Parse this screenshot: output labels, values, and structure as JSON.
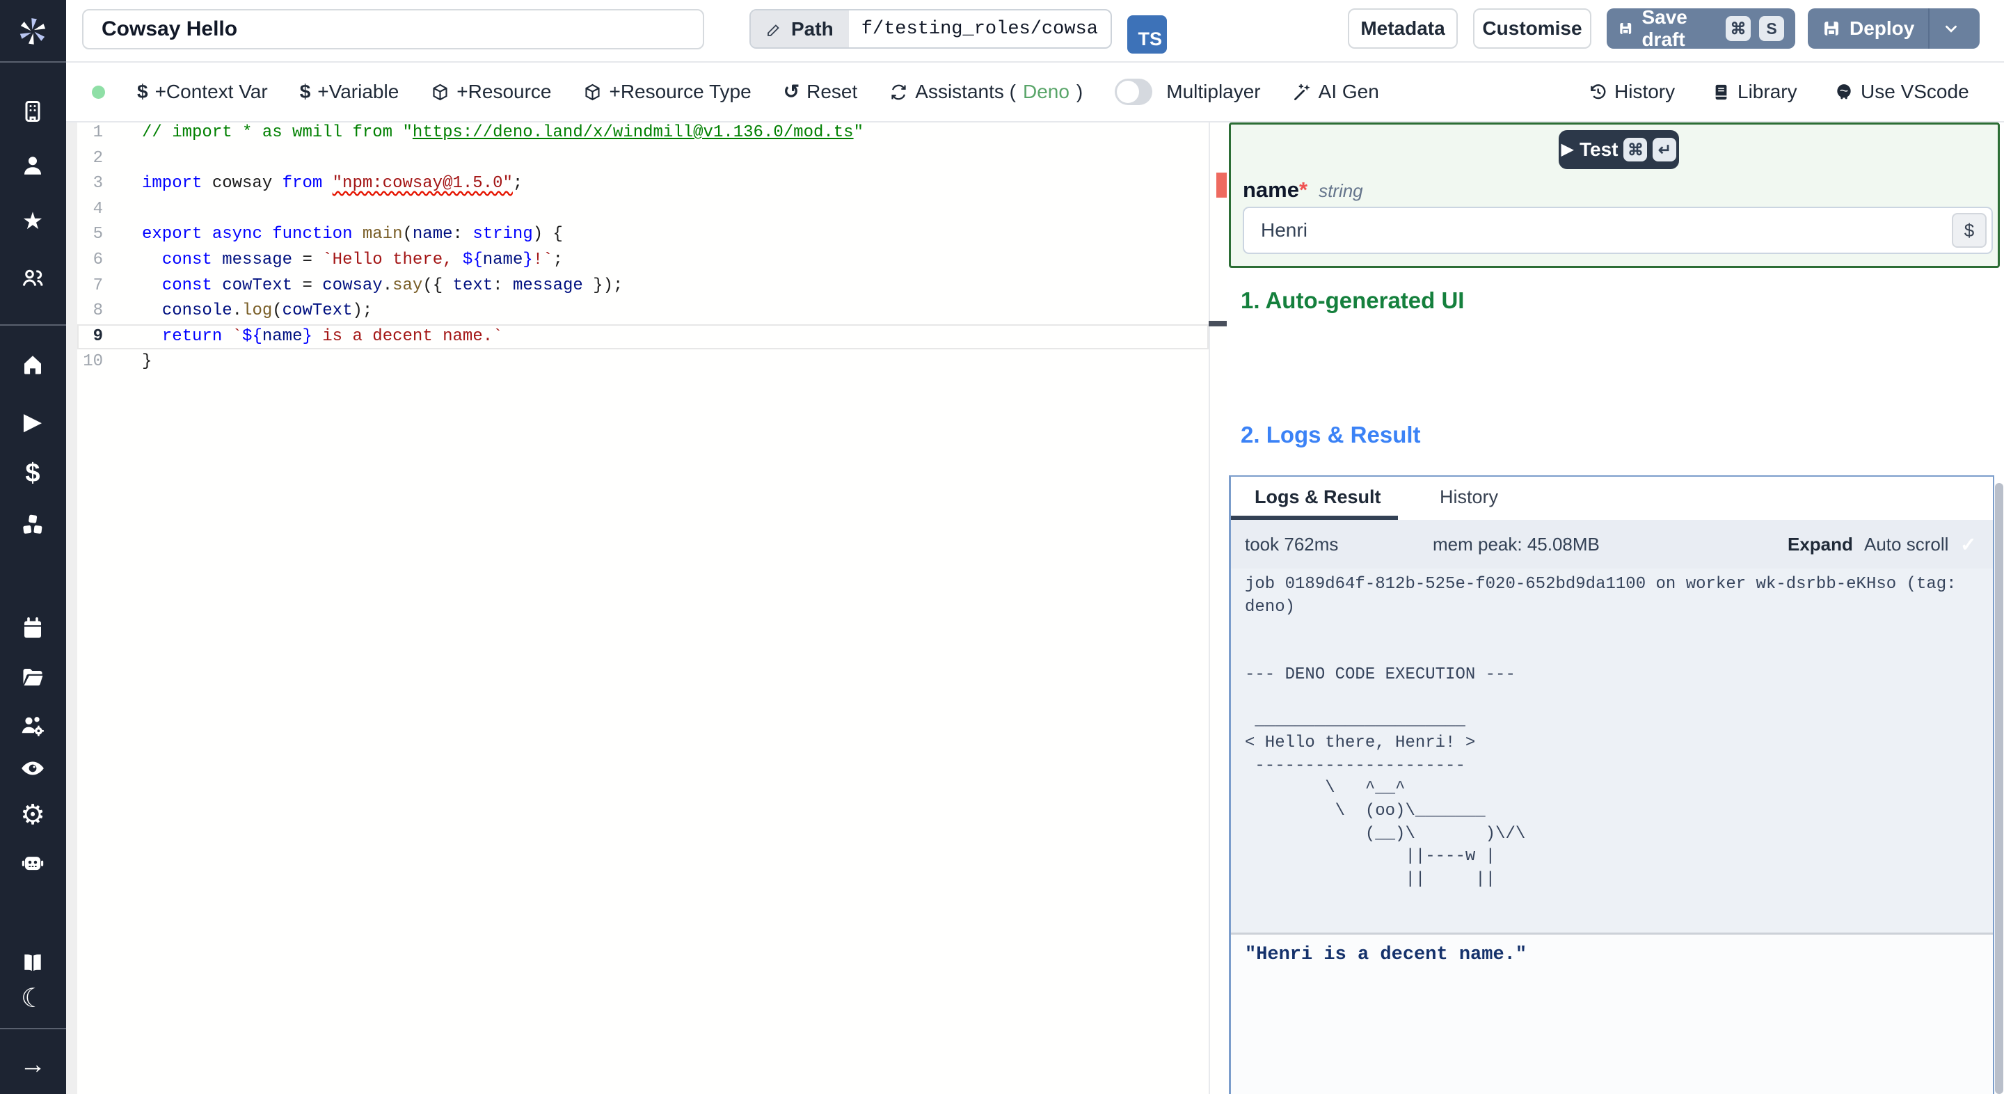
{
  "topbar": {
    "title_value": "Cowsay Hello",
    "path_label": "Path",
    "path_value": "f/testing_roles/cowsa",
    "lang_badge": "TS",
    "metadata_label": "Metadata",
    "customise_label": "Customise",
    "save_draft_label": "Save draft",
    "save_draft_keys": [
      "⌘",
      "S"
    ],
    "deploy_label": "Deploy"
  },
  "toolbar": {
    "status_dot_color": "#8fdfa6",
    "buttons": [
      {
        "icon": "dollar-icon",
        "label": "+Context Var"
      },
      {
        "icon": "dollar-icon",
        "label": "+Variable"
      },
      {
        "icon": "package-icon",
        "label": "+Resource"
      },
      {
        "icon": "package-icon",
        "label": "+Resource Type"
      },
      {
        "icon": "reset-icon",
        "label": "Reset"
      }
    ],
    "reset_glyph": "↺",
    "dollar_glyph": "$",
    "assistants": {
      "prefix": "Assistants (",
      "lang": "Deno",
      "suffix": ")",
      "lang_color": "#59a569"
    },
    "multiplayer_label": "Multiplayer",
    "ai_gen_label": "AI Gen",
    "right": [
      {
        "icon": "history-icon",
        "label": "History"
      },
      {
        "icon": "library-icon",
        "label": "Library"
      },
      {
        "icon": "vscode-icon",
        "label": "Use VScode"
      }
    ]
  },
  "sidebar": {
    "icons": [
      "windmill-logo",
      "workspace-building-icon",
      "user-icon",
      "favorites-star-icon",
      "groups-users-icon",
      "home-icon",
      "runs-play-icon",
      "variables-dollar-icon",
      "resources-cubes-icon",
      "schedules-calendar-icon",
      "folders-icon",
      "workers-users-gear-icon",
      "audit-eye-icon",
      "settings-gear-icon",
      "ai-robot-icon",
      "docs-book-icon",
      "dark-mode-moon-icon",
      "collapse-arrow-icon"
    ],
    "glyphs": {
      "star": "★",
      "play": "▶",
      "dollar": "$",
      "gear": "⚙",
      "moon": "☾",
      "arrow": "→"
    }
  },
  "editor": {
    "lines": [
      {
        "n": 1,
        "tokens": [
          [
            "// import * as wmill from \"",
            "cmt"
          ],
          [
            "https://deno.land/x/windmill@v1.136.0/mod.ts",
            "cmt link"
          ],
          [
            "\"",
            "cmt"
          ]
        ]
      },
      {
        "n": 2,
        "tokens": []
      },
      {
        "n": 3,
        "tokens": [
          [
            "import",
            "kw"
          ],
          [
            " cowsay ",
            "pln"
          ],
          [
            "from",
            "kw"
          ],
          [
            " ",
            "pln"
          ],
          [
            "\"npm:cowsay@1.5.0\"",
            "str sq"
          ],
          [
            ";",
            "pln"
          ]
        ]
      },
      {
        "n": 4,
        "tokens": []
      },
      {
        "n": 5,
        "tokens": [
          [
            "export",
            "kw"
          ],
          [
            " ",
            "pln"
          ],
          [
            "async",
            "kw"
          ],
          [
            " ",
            "pln"
          ],
          [
            "function",
            "kw"
          ],
          [
            " ",
            "pln"
          ],
          [
            "main",
            "fn"
          ],
          [
            "(",
            "pln"
          ],
          [
            "name",
            "var"
          ],
          [
            ": ",
            "pln"
          ],
          [
            "string",
            "kw"
          ],
          [
            ") {",
            "pln"
          ]
        ]
      },
      {
        "n": 6,
        "tokens": [
          [
            "  ",
            "pln"
          ],
          [
            "const",
            "kw"
          ],
          [
            " ",
            "pln"
          ],
          [
            "message",
            "var"
          ],
          [
            " = ",
            "pln"
          ],
          [
            "`Hello there, ",
            "str"
          ],
          [
            "${",
            "kw"
          ],
          [
            "name",
            "var"
          ],
          [
            "}",
            "kw"
          ],
          [
            "!`",
            "str"
          ],
          [
            ";",
            "pln"
          ]
        ]
      },
      {
        "n": 7,
        "tokens": [
          [
            "  ",
            "pln"
          ],
          [
            "const",
            "kw"
          ],
          [
            " ",
            "pln"
          ],
          [
            "cowText",
            "var"
          ],
          [
            " = ",
            "pln"
          ],
          [
            "cowsay",
            "var"
          ],
          [
            ".",
            "pln"
          ],
          [
            "say",
            "fn"
          ],
          [
            "({ ",
            "pln"
          ],
          [
            "text",
            "var"
          ],
          [
            ": ",
            "pln"
          ],
          [
            "message",
            "var"
          ],
          [
            " });",
            "pln"
          ]
        ]
      },
      {
        "n": 8,
        "tokens": [
          [
            "  ",
            "pln"
          ],
          [
            "console",
            "var"
          ],
          [
            ".",
            "pln"
          ],
          [
            "log",
            "fn"
          ],
          [
            "(",
            "pln"
          ],
          [
            "cowText",
            "var"
          ],
          [
            ");",
            "pln"
          ]
        ]
      },
      {
        "n": 9,
        "tokens": [
          [
            "  ",
            "pln"
          ],
          [
            "return",
            "kw"
          ],
          [
            " ",
            "pln"
          ],
          [
            "`",
            "str"
          ],
          [
            "${",
            "kw"
          ],
          [
            "name",
            "var"
          ],
          [
            "}",
            "kw"
          ],
          [
            " is a decent name.`",
            "str"
          ]
        ],
        "current": true
      },
      {
        "n": 10,
        "tokens": [
          [
            "}",
            "pln"
          ]
        ]
      }
    ]
  },
  "preview": {
    "test_label": "Test",
    "test_keys": [
      "⌘",
      "↵"
    ],
    "field": {
      "label": "name",
      "required": "*",
      "type": "string",
      "value": "Henri",
      "dollar": "$"
    },
    "section1": "1. Auto-generated UI",
    "section2": "2. Logs & Result",
    "section1_color": "#15803d",
    "section2_color": "#3b82f6",
    "tabs": [
      "Logs & Result",
      "History"
    ],
    "status": {
      "took": "took 762ms",
      "mem": "mem peak: 45.08MB",
      "expand": "Expand",
      "autoscroll": "Auto scroll",
      "check": "✓"
    },
    "log_lines": [
      "job 0189d64f-812b-525e-f020-652bd9da1100 on worker wk-dsrbb-eKHso (tag:",
      "deno)",
      "",
      "",
      "--- DENO CODE EXECUTION ---",
      "",
      " _____________________",
      "< Hello there, Henri! >",
      " ---------------------",
      "        \\   ^__^",
      "         \\  (oo)\\_______",
      "            (__)\\       )\\/\\",
      "                ||----w |",
      "                ||     ||"
    ],
    "result": "\"Henri is a decent name.\""
  }
}
